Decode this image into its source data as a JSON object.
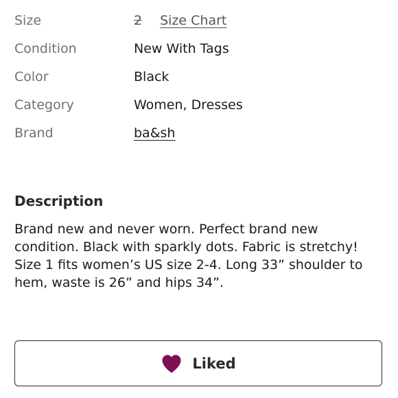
{
  "details": {
    "rows": [
      {
        "label": "Size",
        "value": "2",
        "link": "Size Chart"
      },
      {
        "label": "Condition",
        "value": "New With Tags"
      },
      {
        "label": "Color",
        "value": "Black"
      },
      {
        "label": "Category",
        "value": "Women, Dresses"
      },
      {
        "label": "Brand",
        "value": "ba&sh"
      }
    ]
  },
  "description": {
    "title": "Description",
    "text": "Brand new and never worn. Perfect brand new condition. Black with sparkly dots. Fabric is stretchy! Size 1 fits women’s US size 2-4. Long 33” shoulder to hem, waste is 26” and hips 34”."
  },
  "like_button": {
    "label": "Liked",
    "icon": "heart-icon",
    "icon_color": "#7d0f55"
  }
}
